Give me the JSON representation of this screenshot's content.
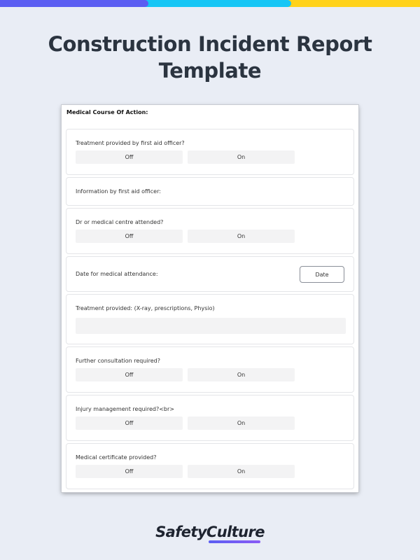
{
  "page": {
    "title": "Construction Incident Report Template",
    "brand": "SafetyCulture"
  },
  "colors": {
    "background": "#e9edf5",
    "accent_purple": "#5b5ef2",
    "accent_cyan": "#16c6f5",
    "accent_yellow": "#ffd21a",
    "title": "#2b3440"
  },
  "form": {
    "section_heading": "Medical Course Of Action:",
    "toggle_off_label": "Off",
    "toggle_on_label": "On",
    "questions": {
      "q1": "Treatment provided by first aid officer?",
      "q2": "Information by first aid officer:",
      "q3": "Dr or medical centre attended?",
      "q4": "Date for medical attendance:",
      "q4_button": "Date",
      "q5": "Treatment provided: (X-ray, prescriptions, Physio)",
      "q6": "Further consultation required?",
      "q7": "Injury management required?<br>",
      "q8": "Medical certificate provided?"
    }
  }
}
